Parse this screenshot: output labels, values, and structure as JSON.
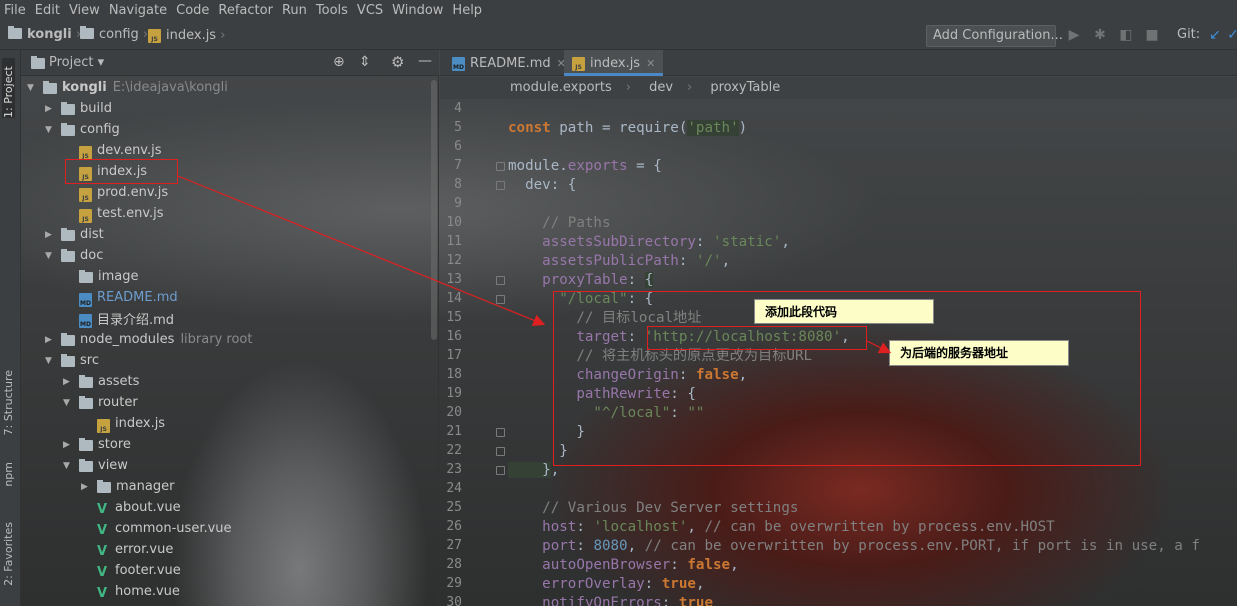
{
  "menu": [
    "File",
    "Edit",
    "View",
    "Navigate",
    "Code",
    "Refactor",
    "Run",
    "Tools",
    "VCS",
    "Window",
    "Help"
  ],
  "breadcrumb": {
    "project": "kongli",
    "folder": "config",
    "file": "index.js"
  },
  "toolbar": {
    "config_button": "Add Configuration...",
    "git_label": "Git:"
  },
  "left_tabs": {
    "project": "1: Project",
    "structure": "7: Structure",
    "npm": "npm",
    "favorites": "2: Favorites"
  },
  "project_panel": {
    "title": "Project",
    "tree": [
      {
        "label": "kongli",
        "note": "E:\\ideajava\\kongli",
        "indent": 0,
        "open": true,
        "type": "folder",
        "bold": true
      },
      {
        "label": "build",
        "indent": 1,
        "open": false,
        "type": "folder"
      },
      {
        "label": "config",
        "indent": 1,
        "open": true,
        "type": "folder"
      },
      {
        "label": "dev.env.js",
        "indent": 2,
        "type": "js"
      },
      {
        "label": "index.js",
        "indent": 2,
        "type": "js"
      },
      {
        "label": "prod.env.js",
        "indent": 2,
        "type": "js"
      },
      {
        "label": "test.env.js",
        "indent": 2,
        "type": "js"
      },
      {
        "label": "dist",
        "indent": 1,
        "open": false,
        "type": "folder"
      },
      {
        "label": "doc",
        "indent": 1,
        "open": true,
        "type": "folder"
      },
      {
        "label": "image",
        "indent": 2,
        "type": "folder-leaf"
      },
      {
        "label": "README.md",
        "indent": 2,
        "type": "md"
      },
      {
        "label": "目录介绍.md",
        "indent": 2,
        "type": "md2"
      },
      {
        "label": "node_modules",
        "note": "library root",
        "indent": 1,
        "open": false,
        "type": "folder"
      },
      {
        "label": "src",
        "indent": 1,
        "open": true,
        "type": "folder"
      },
      {
        "label": "assets",
        "indent": 2,
        "open": false,
        "type": "folder"
      },
      {
        "label": "router",
        "indent": 2,
        "open": true,
        "type": "folder"
      },
      {
        "label": "index.js",
        "indent": 3,
        "type": "js"
      },
      {
        "label": "store",
        "indent": 2,
        "open": false,
        "type": "folder"
      },
      {
        "label": "view",
        "indent": 2,
        "open": true,
        "type": "folder"
      },
      {
        "label": "manager",
        "indent": 3,
        "open": false,
        "type": "folder"
      },
      {
        "label": "about.vue",
        "indent": 3,
        "type": "vue"
      },
      {
        "label": "common-user.vue",
        "indent": 3,
        "type": "vue"
      },
      {
        "label": "error.vue",
        "indent": 3,
        "type": "vue"
      },
      {
        "label": "footer.vue",
        "indent": 3,
        "type": "vue"
      },
      {
        "label": "home.vue",
        "indent": 3,
        "type": "vue"
      }
    ]
  },
  "editor": {
    "tabs": [
      {
        "label": "README.md",
        "active": false
      },
      {
        "label": "index.js",
        "active": true
      }
    ],
    "breadcrumb": [
      "module.exports",
      "dev",
      "proxyTable"
    ],
    "line_numbers": [
      "4",
      "5",
      "6",
      "7",
      "8",
      "9",
      "10",
      "11",
      "12",
      "13",
      "14",
      "15",
      "16",
      "17",
      "18",
      "19",
      "20",
      "21",
      "22",
      "23",
      "24",
      "25",
      "26",
      "27",
      "28",
      "29",
      "30"
    ],
    "lines": [
      [],
      [
        [
          "kw",
          "const"
        ],
        [
          "pl",
          " path = require("
        ],
        [
          "str hl",
          "'path'"
        ],
        [
          "pl",
          ")"
        ]
      ],
      [],
      [
        [
          "pl",
          "module."
        ],
        [
          "prop",
          "exports"
        ],
        [
          "pl",
          " = {"
        ]
      ],
      [
        [
          "pl",
          "  dev: {"
        ]
      ],
      [],
      [
        [
          "cmt",
          "    // Paths"
        ]
      ],
      [
        [
          "prop",
          "    assetsSubDirectory"
        ],
        [
          "pl",
          ": "
        ],
        [
          "str",
          "'static'"
        ],
        [
          "pl",
          ","
        ]
      ],
      [
        [
          "prop",
          "    assetsPublicPath"
        ],
        [
          "pl",
          ": "
        ],
        [
          "str",
          "'/'"
        ],
        [
          "pl",
          ","
        ]
      ],
      [
        [
          "prop",
          "    proxyTable"
        ],
        [
          "pl",
          ": "
        ],
        [
          "pl hl",
          "{"
        ]
      ],
      [
        [
          "str",
          "      \"/local\""
        ],
        [
          "pl",
          ": {"
        ]
      ],
      [
        [
          "cmt",
          "        // 目标local地址"
        ]
      ],
      [
        [
          "prop",
          "        target"
        ],
        [
          "pl",
          ": "
        ],
        [
          "str",
          "'http://localhost:8080'"
        ],
        [
          "pl",
          ","
        ]
      ],
      [
        [
          "cmt",
          "        // 将主机标头的原点更改为目标URL"
        ]
      ],
      [
        [
          "prop",
          "        changeOrigin"
        ],
        [
          "pl",
          ": "
        ],
        [
          "kw",
          "false"
        ],
        [
          "pl",
          ","
        ]
      ],
      [
        [
          "prop",
          "        pathRewrite"
        ],
        [
          "pl",
          ": {"
        ]
      ],
      [
        [
          "str",
          "          \"^/local\""
        ],
        [
          "pl",
          ": "
        ],
        [
          "str",
          "\"\""
        ]
      ],
      [
        [
          "pl",
          "        }"
        ]
      ],
      [
        [
          "pl",
          "      }"
        ]
      ],
      [
        [
          "pl hl",
          "    }"
        ],
        [
          "pl",
          ","
        ]
      ],
      [],
      [
        [
          "cmt",
          "    // Various Dev Server settings"
        ]
      ],
      [
        [
          "prop",
          "    host"
        ],
        [
          "pl",
          ": "
        ],
        [
          "str",
          "'localhost'"
        ],
        [
          "pl",
          ", "
        ],
        [
          "cmt",
          "// can be overwritten by process.env.HOST"
        ]
      ],
      [
        [
          "prop",
          "    port"
        ],
        [
          "pl",
          ": "
        ],
        [
          "num",
          "8080"
        ],
        [
          "pl",
          ", "
        ],
        [
          "cmt",
          "// can be overwritten by process.env.PORT, if port is in use, a f"
        ]
      ],
      [
        [
          "prop",
          "    autoOpenBrowser"
        ],
        [
          "pl",
          ": "
        ],
        [
          "kw",
          "false"
        ],
        [
          "pl",
          ","
        ]
      ],
      [
        [
          "prop",
          "    errorOverlay"
        ],
        [
          "pl",
          ": "
        ],
        [
          "kw",
          "true"
        ],
        [
          "pl",
          ","
        ]
      ],
      [
        [
          "prop",
          "    notifyOnErrors"
        ],
        [
          "pl",
          ": "
        ],
        [
          "kw",
          "true"
        ]
      ]
    ]
  },
  "annotations": {
    "add_code": "添加此段代码",
    "backend_address": "为后端的服务器地址"
  },
  "colors": {
    "annotation_red": "#e02020",
    "note_bg": "#fdfdc8",
    "tab_accent": "#4a88c7"
  }
}
